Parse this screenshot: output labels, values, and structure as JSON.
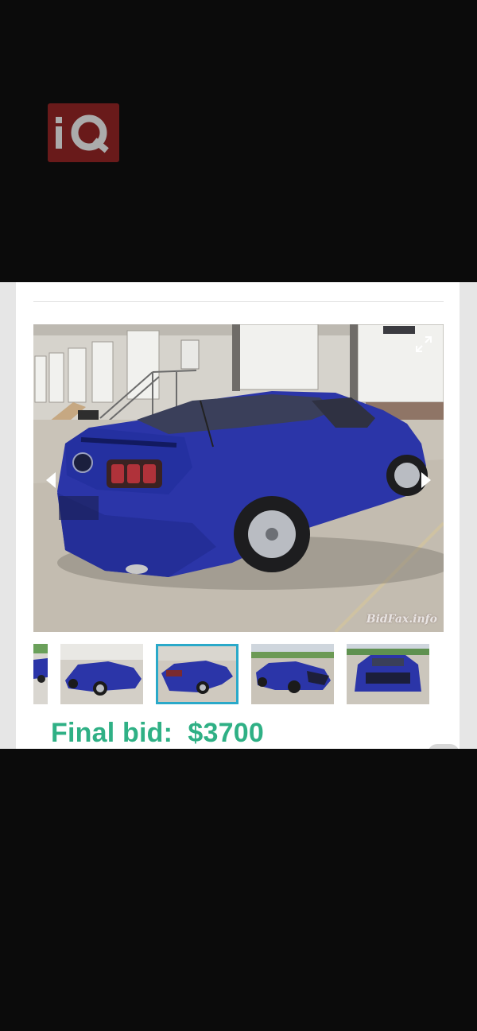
{
  "logo": {
    "text": "iQ",
    "color": "#7a1d1d"
  },
  "gallery": {
    "watermark": "BidFax.info",
    "car_color": "#2b35a8",
    "thumbnails": [
      {
        "label": "partial-rear-view"
      },
      {
        "label": "rear-left-view"
      },
      {
        "label": "rear-left-view-selected"
      },
      {
        "label": "front-left-damaged-view"
      },
      {
        "label": "front-view"
      }
    ],
    "selected_index": 2
  },
  "listing": {
    "final_bid_label": "Final bid:",
    "final_bid_value": "$3700",
    "accent": "#2fb085"
  }
}
